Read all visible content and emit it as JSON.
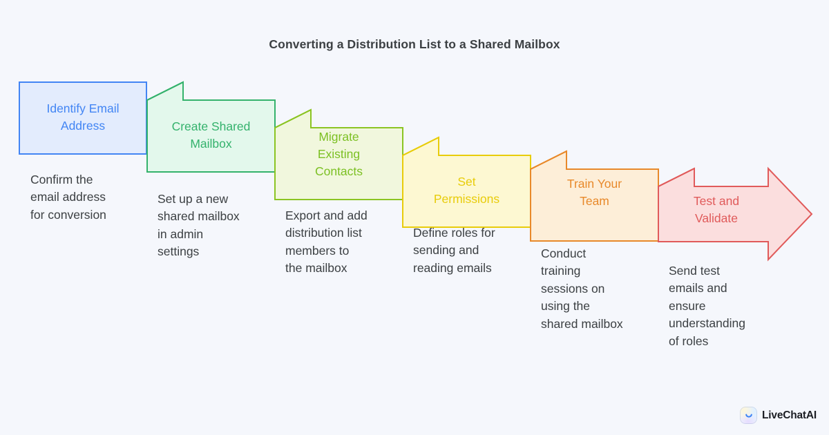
{
  "page": {
    "title": "Converting a Distribution List to a Shared Mailbox",
    "background_color": "#f5f7fc",
    "title_color": "#3c4043",
    "caption_color": "#3c4043"
  },
  "diagram": {
    "type": "chevron-process-arrow",
    "step_count": 6,
    "steps": [
      {
        "index": 1,
        "label": "Identify Email\nAddress",
        "caption": "Confirm the\nemail address\nfor conversion",
        "fill": "#e3ecfd",
        "stroke": "#4285f4",
        "text_color": "#4285f4"
      },
      {
        "index": 2,
        "label": "Create Shared\nMailbox",
        "caption": "Set up a new\nshared mailbox\nin admin\nsettings",
        "fill": "#e3f8ec",
        "stroke": "#34b26c",
        "text_color": "#34b26c"
      },
      {
        "index": 3,
        "label": "Migrate\nExisting\nContacts",
        "caption": "Export and add\ndistribution list\nmembers to\nthe mailbox",
        "fill": "#f1f7dd",
        "stroke": "#8bc422",
        "text_color": "#7cc023"
      },
      {
        "index": 4,
        "label": "Set\nPermissions",
        "caption": "Define roles for\nsending and\nreading emails",
        "fill": "#fdf8d2",
        "stroke": "#e8cc0a",
        "text_color": "#e8cc0a"
      },
      {
        "index": 5,
        "label": "Train Your\nTeam",
        "caption": "Conduct\ntraining\nsessions on\nusing the\nshared mailbox",
        "fill": "#fdeed8",
        "stroke": "#e8892a",
        "text_color": "#e8892a"
      },
      {
        "index": 6,
        "label": "Test and\nValidate",
        "caption": "Send test\nemails and\nensure\nunderstanding\nof roles",
        "fill": "#fbdede",
        "stroke": "#e05a5a",
        "text_color": "#e05a5a"
      }
    ]
  },
  "branding": {
    "name": "LiveChatAI",
    "icon": "livechatai-smile-icon"
  }
}
